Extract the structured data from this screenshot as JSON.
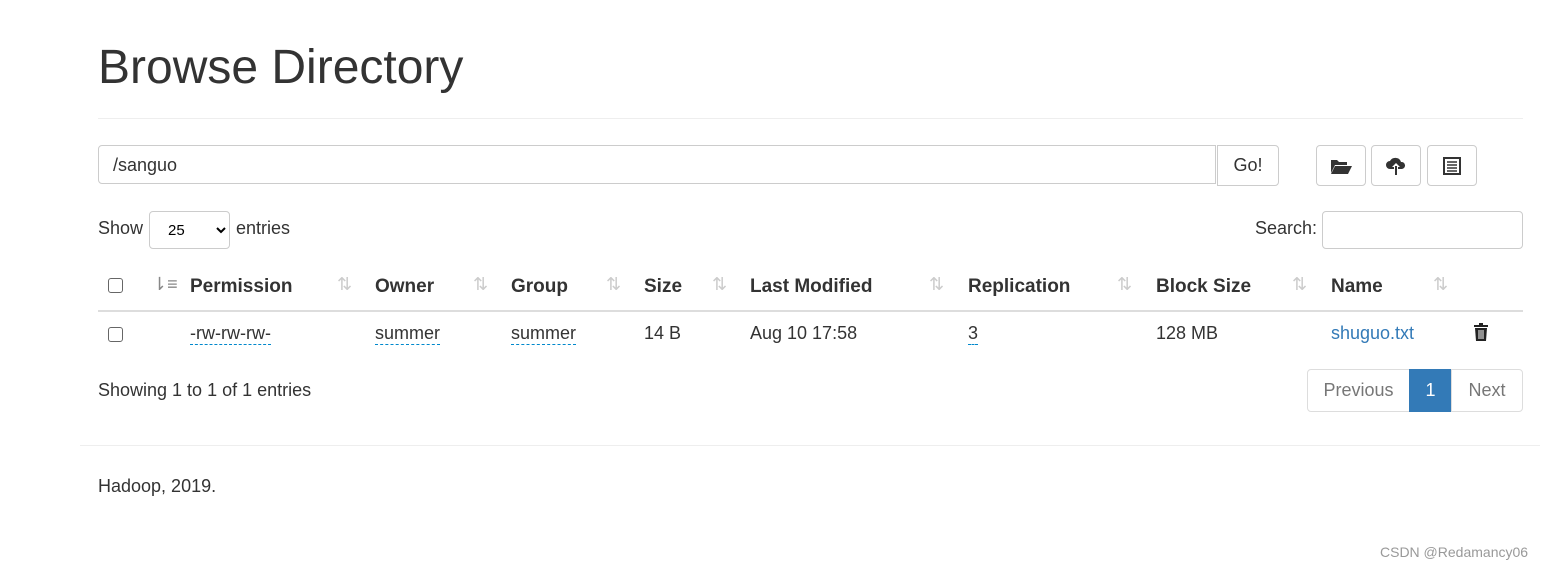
{
  "page": {
    "title": "Browse Directory",
    "footer": "Hadoop, 2019.",
    "watermark": "CSDN @Redamancy06"
  },
  "toolbar": {
    "path": "/sanguo",
    "go_label": "Go!",
    "icons": [
      "folder-open-icon",
      "cloud-upload-icon",
      "list-alt-icon"
    ]
  },
  "table_controls": {
    "show_label": "Show",
    "entries_label": "entries",
    "page_size": "25",
    "search_label": "Search:",
    "search_value": ""
  },
  "table": {
    "columns": [
      "Permission",
      "Owner",
      "Group",
      "Size",
      "Last Modified",
      "Replication",
      "Block Size",
      "Name"
    ],
    "rows": [
      {
        "permission": "-rw-rw-rw-",
        "owner": "summer",
        "group": "summer",
        "size": "14 B",
        "last_modified": "Aug 10 17:58",
        "replication": "3",
        "block_size": "128 MB",
        "name": "shuguo.txt"
      }
    ]
  },
  "pagination": {
    "info": "Showing 1 to 1 of 1 entries",
    "previous": "Previous",
    "current": "1",
    "next": "Next"
  },
  "colors": {
    "accent": "#337ab7"
  }
}
